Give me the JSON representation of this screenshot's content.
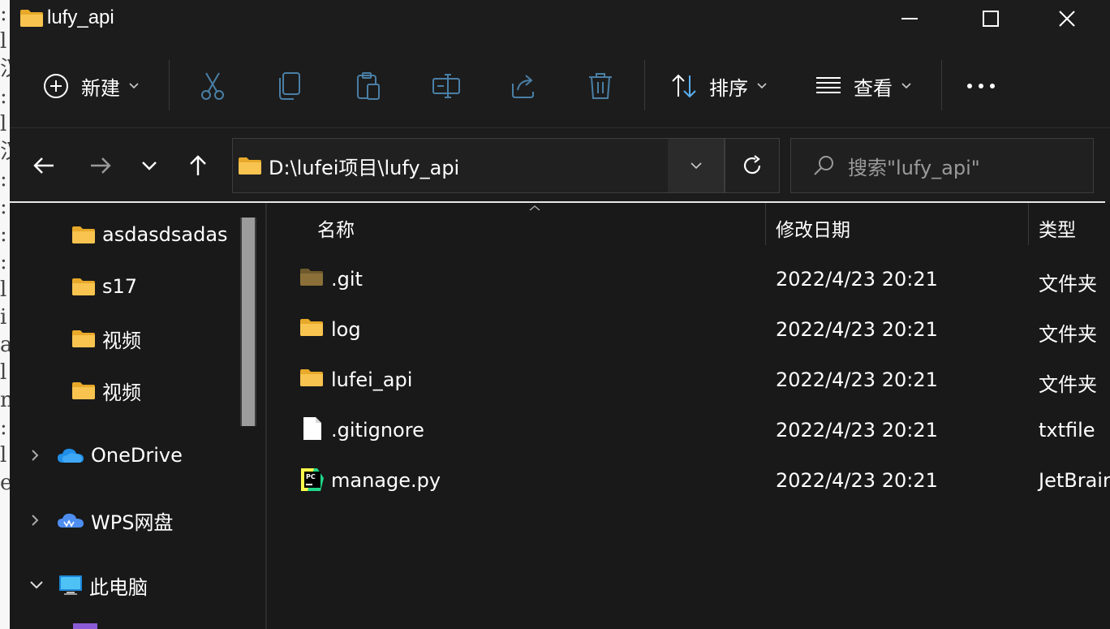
{
  "background_text": [
    ":",
    "l",
    "汉",
    ":",
    "l",
    "汉",
    ":",
    ":",
    ":",
    ":",
    "l",
    "i",
    "a",
    "l",
    "n",
    ":",
    "l",
    "e"
  ],
  "window": {
    "title": "lufy_api"
  },
  "commandbar": {
    "new_label": "新建",
    "sort_label": "排序",
    "view_label": "查看"
  },
  "address": {
    "path": "D:\\lufei项目\\lufy_api",
    "search_placeholder": "搜索\"lufy_api\""
  },
  "nav_pane": {
    "folders": [
      "asdasdsadas",
      "s17",
      "视频",
      "视频"
    ],
    "onedrive": "OneDrive",
    "wps": "WPS网盘",
    "this_pc": "此电脑"
  },
  "columns": {
    "name": "名称",
    "modified": "修改日期",
    "type": "类型"
  },
  "files": [
    {
      "name": ".git",
      "date": "2022/4/23 20:21",
      "type": "文件夹",
      "icon": "folder-icon-dim"
    },
    {
      "name": "log",
      "date": "2022/4/23 20:21",
      "type": "文件夹",
      "icon": "folder-icon"
    },
    {
      "name": "lufei_api",
      "date": "2022/4/23 20:21",
      "type": "文件夹",
      "icon": "folder-icon"
    },
    {
      "name": ".gitignore",
      "date": "2022/4/23 20:21",
      "type": "txtfile",
      "icon": "file-icon"
    },
    {
      "name": "manage.py",
      "date": "2022/4/23 20:21",
      "type": "JetBrains",
      "icon": "pycharm-icon"
    }
  ],
  "colors": {
    "window_bg": "#191919",
    "toolbar_bg": "#1c1c1c",
    "folder_yellow": "#f8c44f",
    "accent_blue": "#5ab0f0"
  }
}
